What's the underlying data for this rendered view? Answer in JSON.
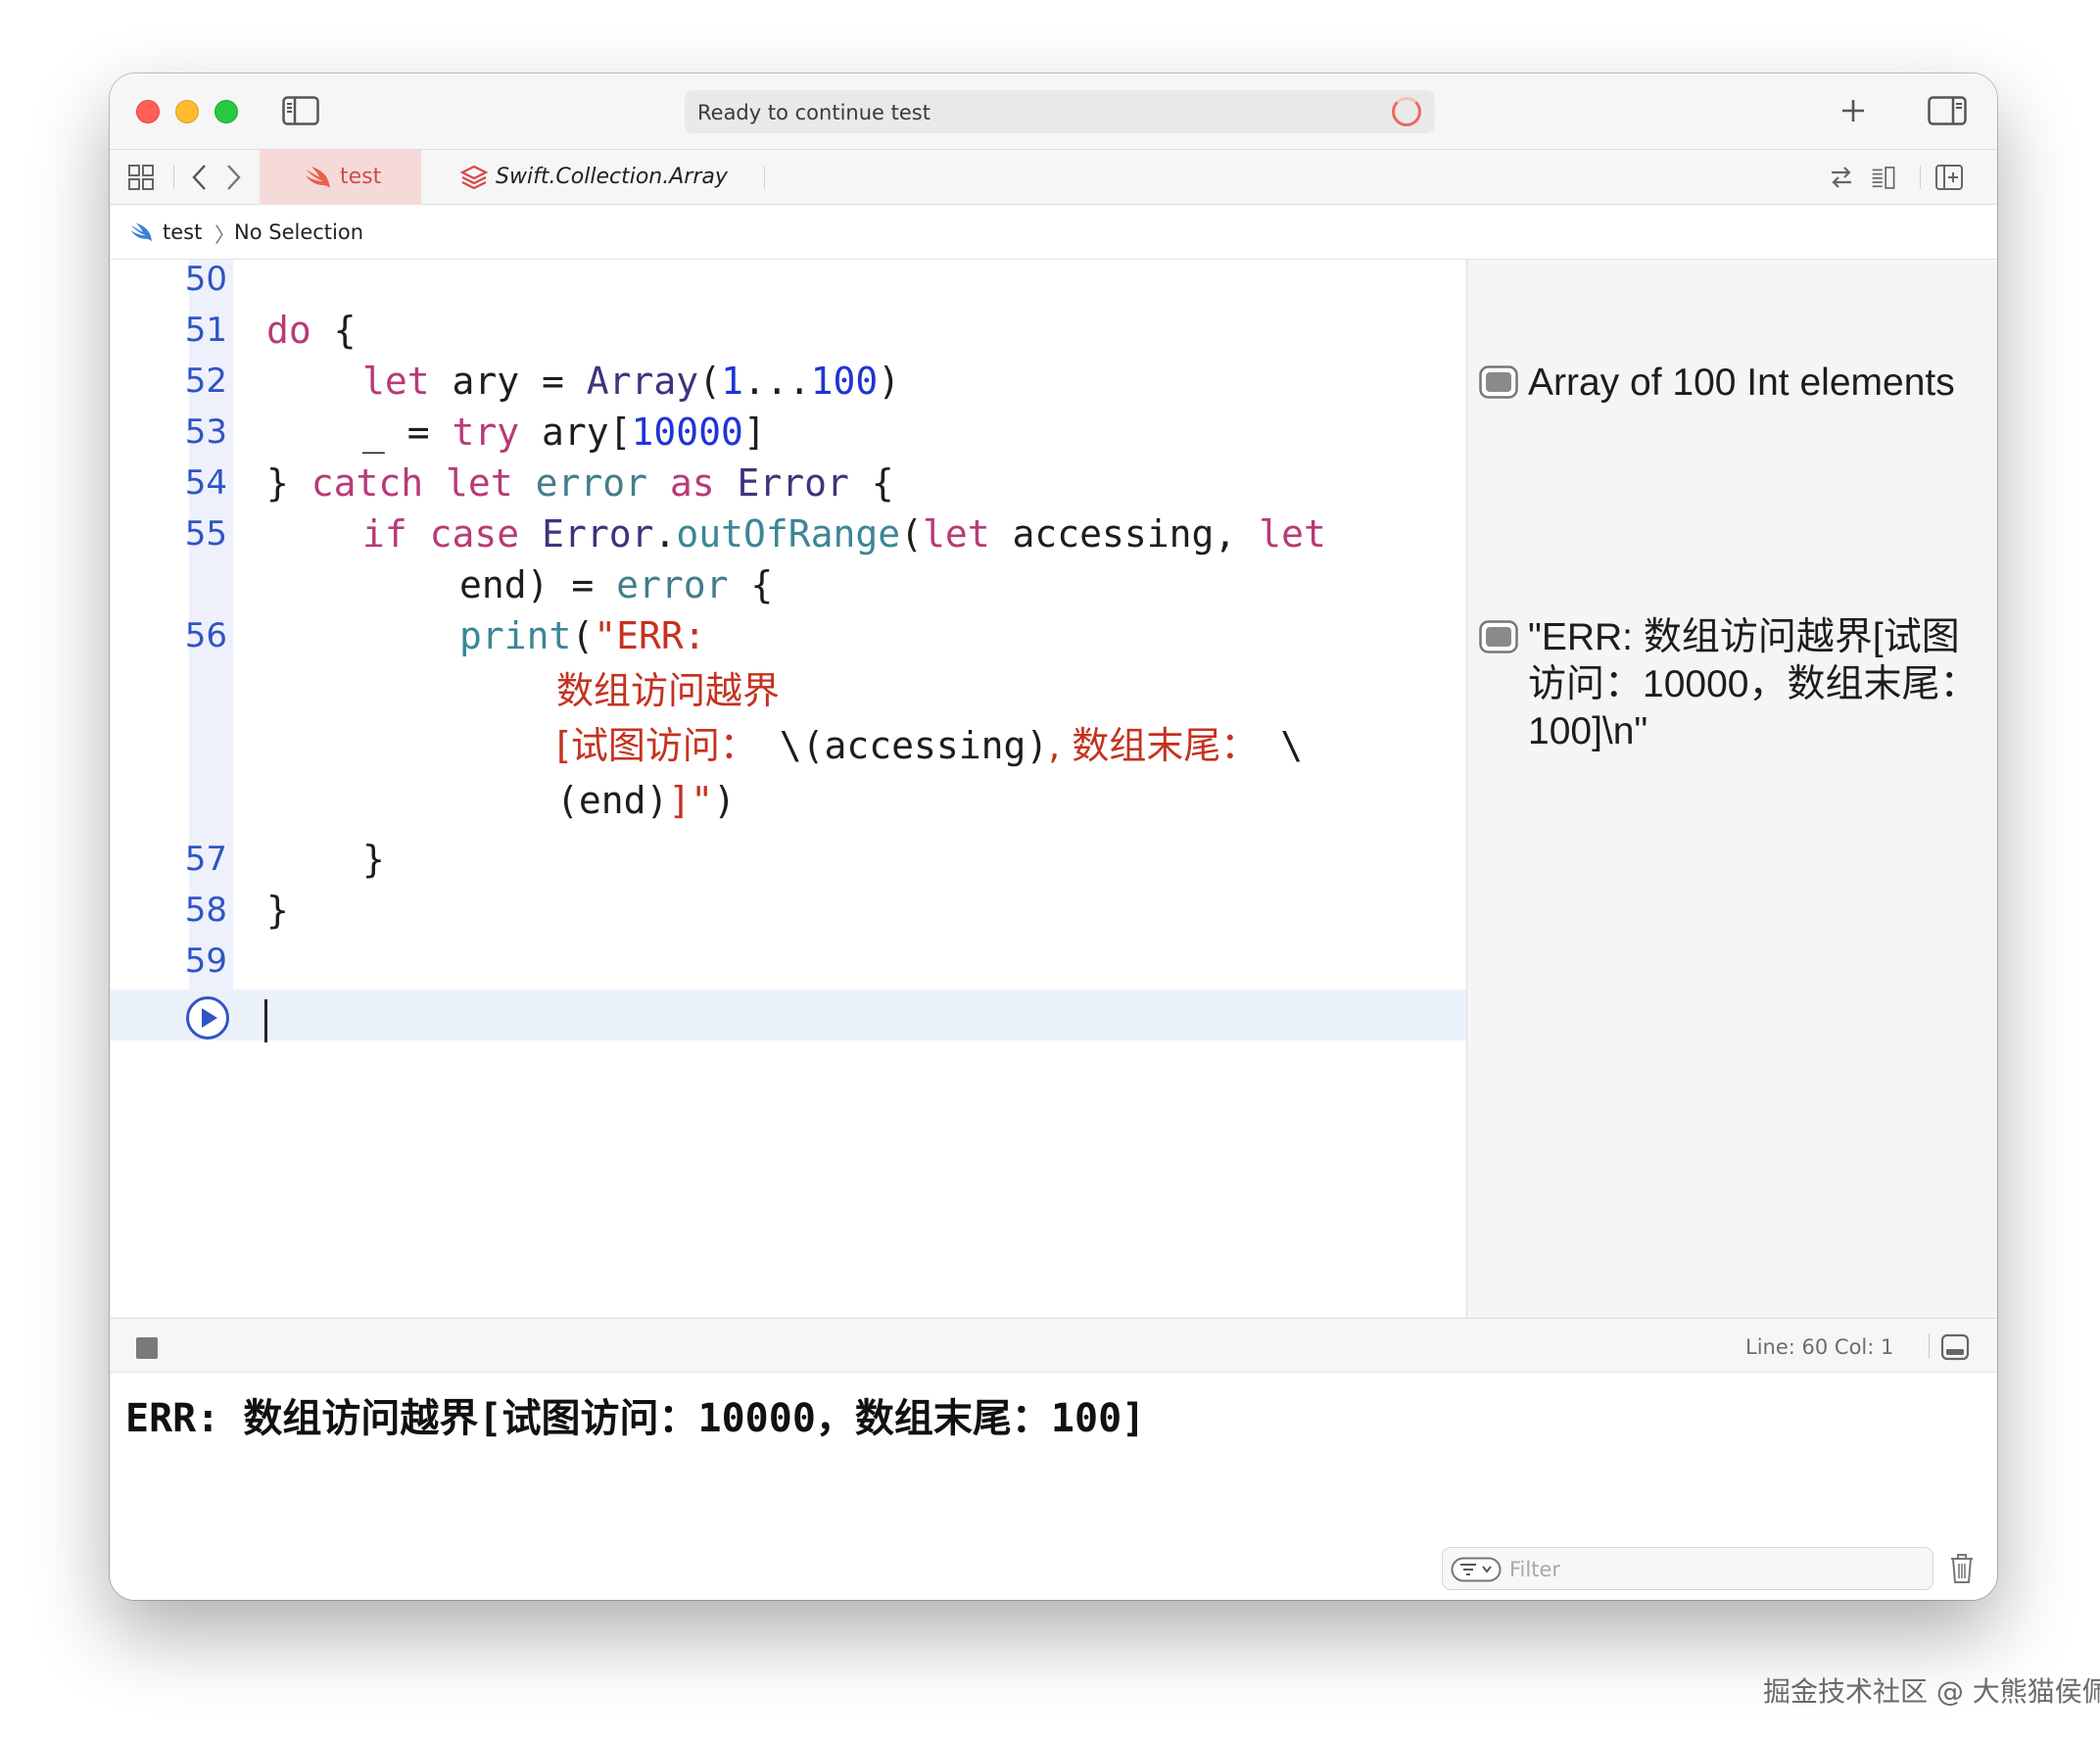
{
  "window": {
    "activity_text": "Ready to continue test"
  },
  "tabs": [
    {
      "label": "test",
      "icon": "swift-icon",
      "active": true
    },
    {
      "label": "Swift.Collection.Array",
      "icon": "stack-icon",
      "active": false
    }
  ],
  "breadcrumb": {
    "project": "test",
    "separator": "〉",
    "selection": "No Selection"
  },
  "editor": {
    "line_numbers": [
      "50",
      "51",
      "52",
      "53",
      "54",
      "55",
      "56",
      "57",
      "58",
      "59"
    ],
    "code": {
      "l51_kw": "do",
      "l51_rest": " {",
      "l52_kw": "let",
      "l52_a": " ary = ",
      "l52_ty": "Array",
      "l52_b": "(",
      "l52_n1": "1",
      "l52_c": "...",
      "l52_n2": "100",
      "l52_d": ")",
      "l53_a": "_ = ",
      "l53_kw": "try",
      "l53_b": " ary[",
      "l53_n": "10000",
      "l53_c": "]",
      "l54_a": "} ",
      "l54_kw1": "catch",
      "l54_sp1": " ",
      "l54_kw2": "let",
      "l54_sp2": " ",
      "l54_pr": "error",
      "l54_sp3": " ",
      "l54_kw3": "as",
      "l54_sp4": " ",
      "l54_ty": "Error",
      "l54_b": " {",
      "l55_kw1": "if",
      "l55_sp1": " ",
      "l55_kw2": "case",
      "l55_sp2": " ",
      "l55_ty": "Error",
      "l55_dot": ".",
      "l55_fn": "outOfRange",
      "l55_p": "(",
      "l55_kw3": "let",
      "l55_b": " accessing, ",
      "l55_kw4": "let",
      "l55w_a": "end) = ",
      "l55w_pr": "error",
      "l55w_b": " {",
      "l56_fn": "print",
      "l56_p": "(",
      "l56_str": "\"ERR:",
      "l56w1": "数组访问越界",
      "l56w2_str1": "[试图访问：",
      "l56w2_a": " \\(accessing)",
      "l56w2_str2": ", 数组末尾：",
      "l56w2_b": " \\",
      "l56w3_a": "(end)",
      "l56w3_str": "]\"",
      "l56w3_b": ")",
      "l57": "}",
      "l58": "}"
    }
  },
  "results": [
    {
      "text": "Array of 100 Int elements"
    },
    {
      "text": "\"ERR: 数组访问越界[试图访问：10000，数组末尾：100]\\n\""
    }
  ],
  "debugbar": {
    "line_col": "Line: 60  Col: 1"
  },
  "console": {
    "output": "ERR: 数组访问越界[试图访问：10000，数组末尾：100]",
    "filter_placeholder": "Filter"
  },
  "watermark": "掘金技术社区 @ 大熊猫侯佩",
  "colors": {
    "keyword": "#b83a76",
    "type": "#42317c",
    "number": "#1f34d6",
    "string": "#c4321f",
    "line_number": "#2f55c4",
    "active_tab_bg": "#f6dada"
  }
}
